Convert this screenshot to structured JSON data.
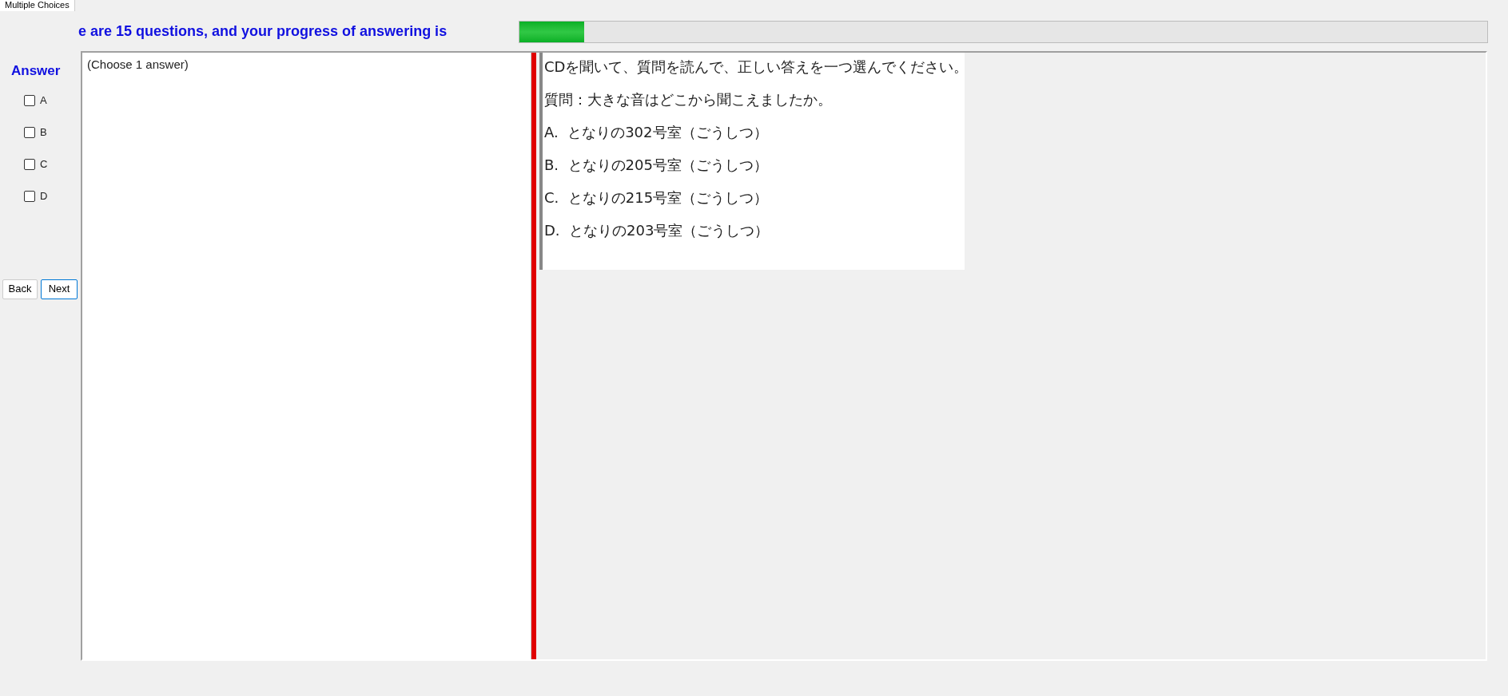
{
  "tabs": [
    {
      "label": "Multiple Choices",
      "selected": true
    }
  ],
  "header": {
    "title": "e are 15 questions, and your progress of answering is",
    "progress": {
      "level": 0.067
    }
  },
  "answer_panel": {
    "heading": "Answer",
    "options": [
      {
        "label": "A",
        "checked": false
      },
      {
        "label": "B",
        "checked": false
      },
      {
        "label": "C",
        "checked": false
      },
      {
        "label": "D",
        "checked": false
      }
    ],
    "buttons": [
      {
        "label": "Back",
        "focused": false
      },
      {
        "label": "Next",
        "focused": true
      }
    ]
  },
  "answer_box": {
    "text": "(Choose 1 answer)"
  },
  "question": {
    "lines": [
      "CDを聞いて、質問を読んで、正しい答えを一つ選んでください。",
      "質問：大きな音はどこから聞こえましたか。",
      "A.  となりの302号室（ごうしつ）",
      "B.  となりの205号室（ごうしつ）",
      "C.  となりの215号室（ごうしつ）",
      "D.  となりの203号室（ごうしつ）"
    ]
  }
}
